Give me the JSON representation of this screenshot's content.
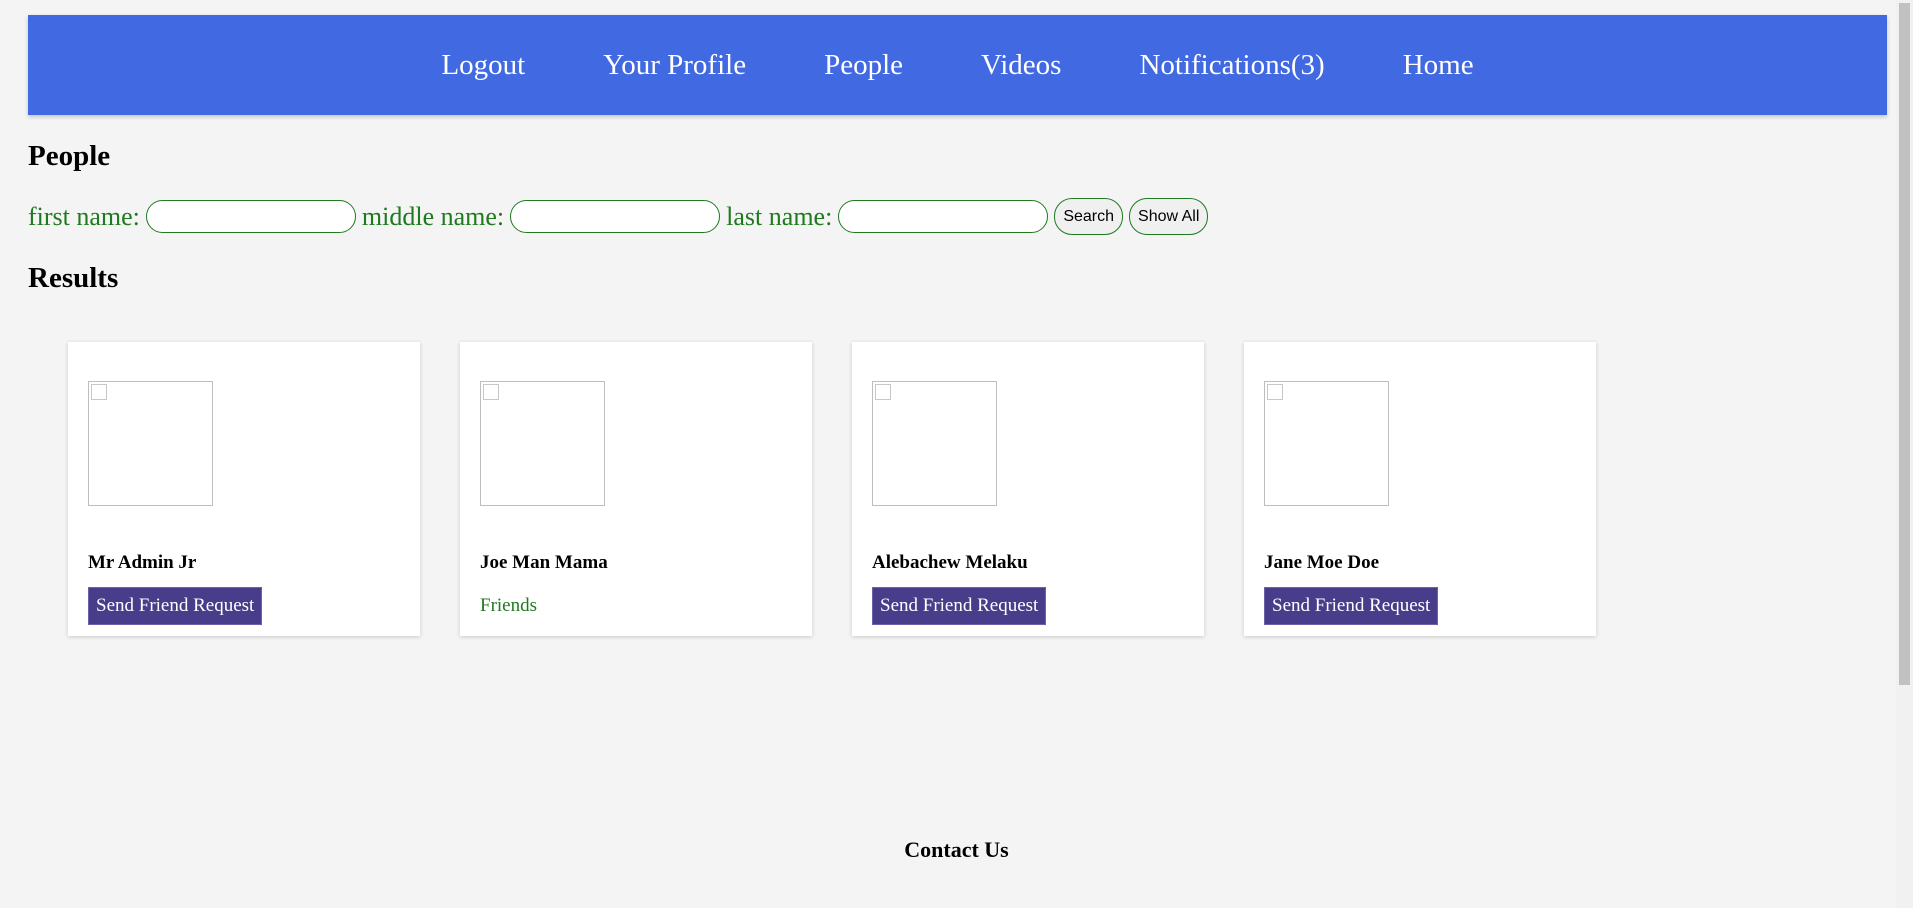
{
  "nav": {
    "items": [
      {
        "label": "Logout"
      },
      {
        "label": "Your Profile"
      },
      {
        "label": "People"
      },
      {
        "label": "Videos"
      },
      {
        "label": "Notifications(3)"
      },
      {
        "label": "Home"
      }
    ]
  },
  "people_section": {
    "title": "People",
    "search": {
      "first_label": "first name:",
      "first_value": "",
      "middle_label": "middle name:",
      "middle_value": "",
      "last_label": "last name:",
      "last_value": "",
      "search_button": "Search",
      "show_all_button": "Show All"
    }
  },
  "results": {
    "title": "Results",
    "cards": [
      {
        "name": "Mr Admin Jr",
        "action": "Send Friend Request"
      },
      {
        "name": "Joe Man Mama",
        "status": "Friends"
      },
      {
        "name": "Alebachew Melaku",
        "action": "Send Friend Request"
      },
      {
        "name": "Jane Moe Doe",
        "action": "Send Friend Request"
      }
    ]
  },
  "footer": {
    "title": "Contact Us"
  },
  "colors": {
    "nav_background": "#4169e1",
    "accent_green": "#1f7a1f",
    "button_purple": "#483d8b"
  }
}
